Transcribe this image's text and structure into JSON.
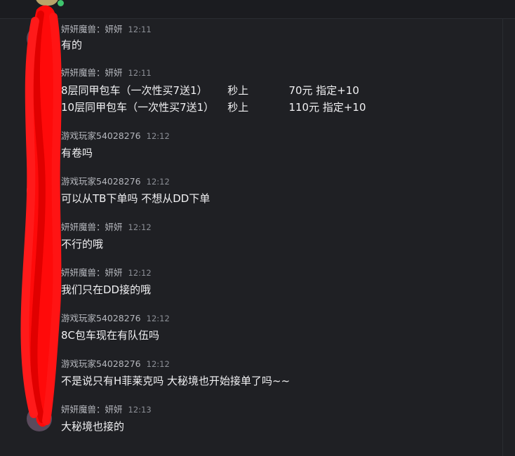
{
  "colors": {
    "background": "#1f2024",
    "sender_text": "#b5b7bd",
    "time_text": "#8c8f96",
    "message_text": "#f1f1f3",
    "redaction_mark": "#ff0a0a",
    "online_indicator": "#3ec46d"
  },
  "chat": {
    "messages": [
      {
        "sender": "妍妍魔兽：妍妍",
        "time": "12:11",
        "lines": [
          "有的"
        ]
      },
      {
        "sender": "妍妍魔兽：妍妍",
        "time": "12:11",
        "lines": [
          "8层同甲包车（一次性买7送1）      秒上            70元 指定+10",
          "10层同甲包车（一次性买7送1）    秒上            110元 指定+10"
        ]
      },
      {
        "sender": "游戏玩家54028276",
        "time": "12:12",
        "lines": [
          "有卷吗"
        ]
      },
      {
        "sender": "游戏玩家54028276",
        "time": "12:12",
        "lines": [
          "可以从TB下单吗 不想从DD下单"
        ]
      },
      {
        "sender": "妍妍魔兽：妍妍",
        "time": "12:12",
        "lines": [
          "不行的哦"
        ]
      },
      {
        "sender": "妍妍魔兽：妍妍",
        "time": "12:12",
        "lines": [
          "我们只在DD接的哦"
        ]
      },
      {
        "sender": "游戏玩家54028276",
        "time": "12:12",
        "lines": [
          "8C包车现在有队伍吗"
        ]
      },
      {
        "sender": "游戏玩家54028276",
        "time": "12:12",
        "lines": [
          "不是说只有H菲莱克吗 大秘境也开始接单了吗~~"
        ]
      },
      {
        "sender": "妍妍魔兽：妍妍",
        "time": "12:13",
        "lines": [
          "大秘境也接的"
        ]
      }
    ]
  }
}
